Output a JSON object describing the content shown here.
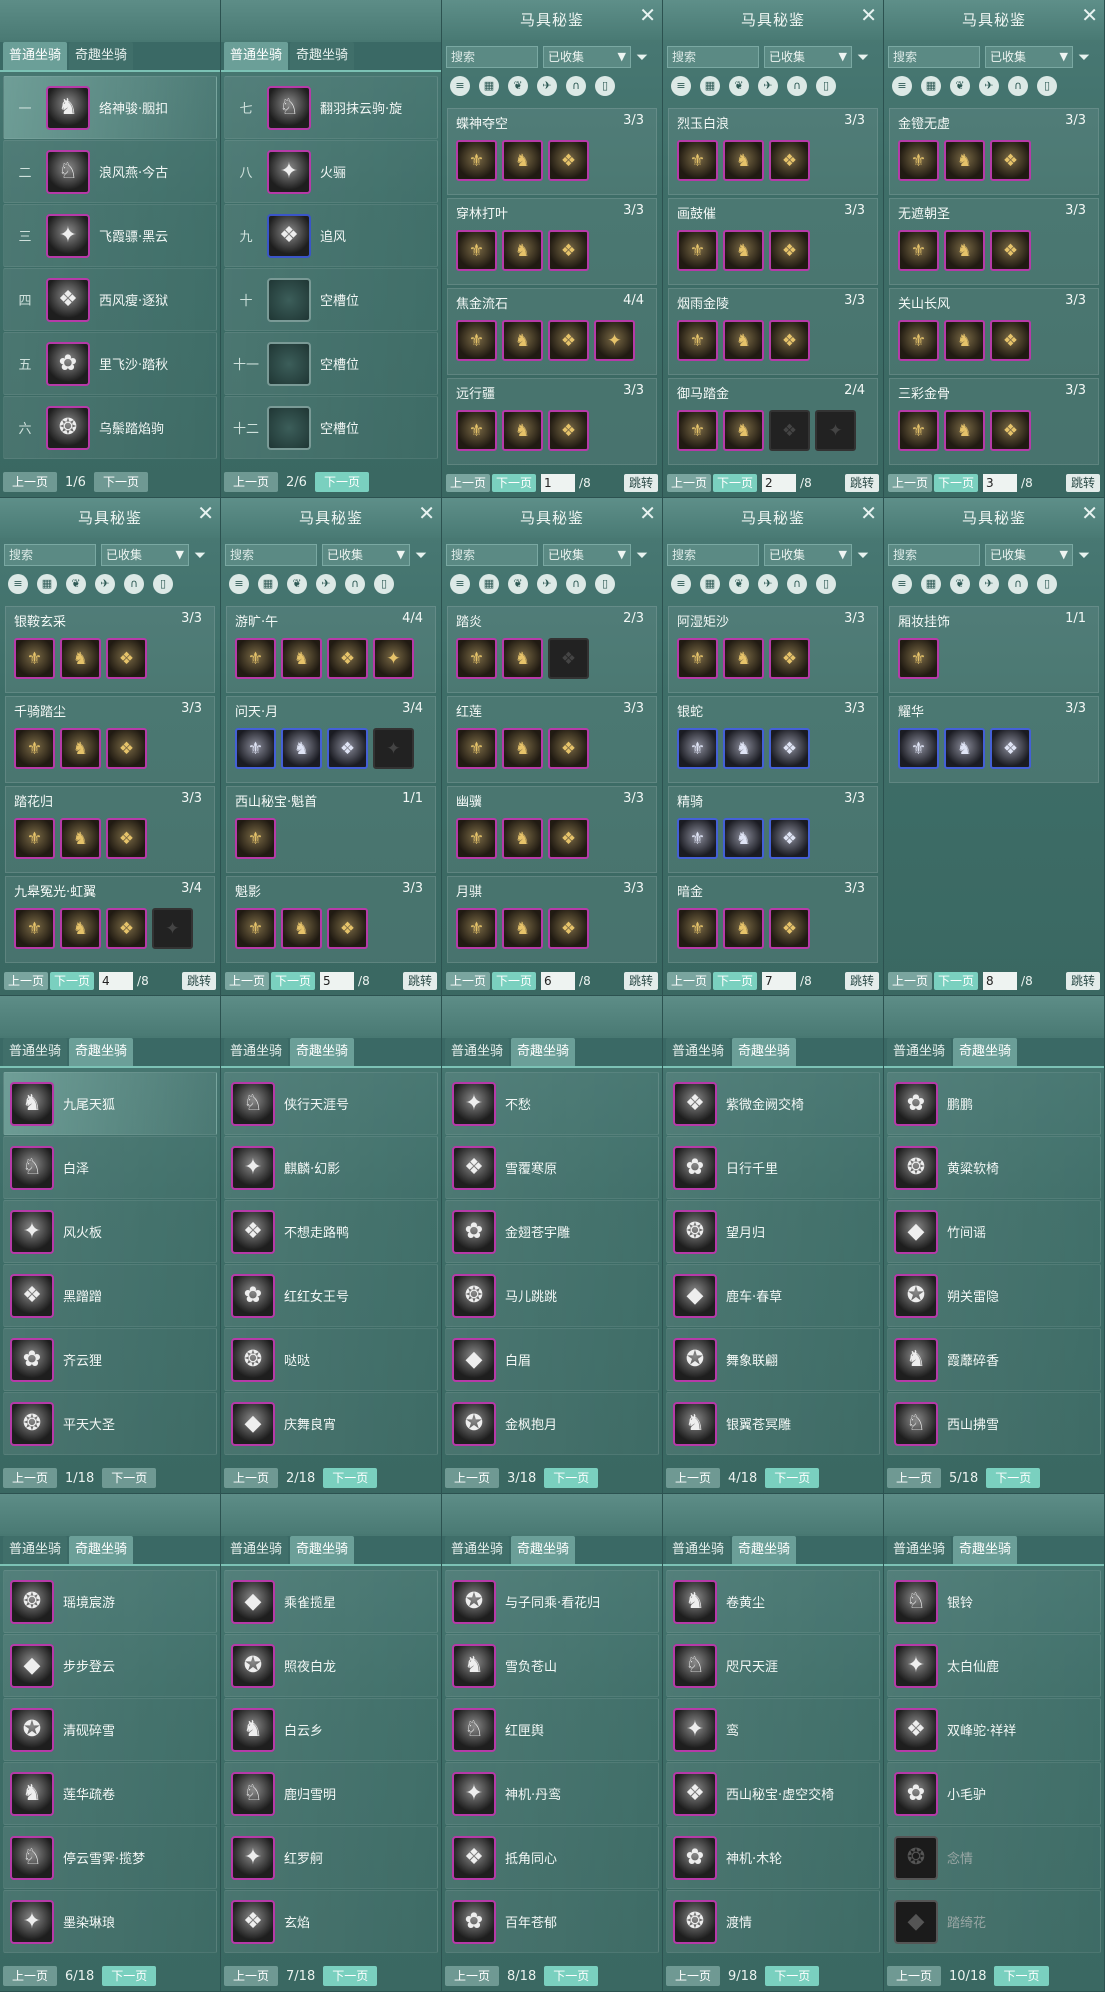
{
  "tabs": {
    "normal": "普通坐骑",
    "fun": "奇趣坐骑"
  },
  "pager": {
    "prev": "上一页",
    "next": "下一页"
  },
  "collection": {
    "title": "马具秘鉴",
    "search_placeholder": "搜索",
    "filter": "已收集",
    "jump": "跳转",
    "total": "/8"
  },
  "icons": {
    "close": "close-icon",
    "funnel": "funnel-icon",
    "tab_active_color": "#6b9f98",
    "accent": "#7ad0bf"
  },
  "normal_pages": [
    {
      "page": "1/6",
      "rows": [
        {
          "num": "一",
          "name": "络神骏·胭扣"
        },
        {
          "num": "二",
          "name": "浪风燕·今古"
        },
        {
          "num": "三",
          "name": "飞霞骠·黑云"
        },
        {
          "num": "四",
          "name": "西风瘦·逐狱"
        },
        {
          "num": "五",
          "name": "里飞沙·踏秋"
        },
        {
          "num": "六",
          "name": "乌鬃踏焰驹"
        }
      ]
    },
    {
      "page": "2/6",
      "rows": [
        {
          "num": "七",
          "name": "翻羽抹云驹·旋"
        },
        {
          "num": "八",
          "name": "火骊"
        },
        {
          "num": "九",
          "name": "追风"
        },
        {
          "num": "十",
          "name": "空槽位"
        },
        {
          "num": "十一",
          "name": "空槽位"
        },
        {
          "num": "十二",
          "name": "空槽位"
        }
      ]
    }
  ],
  "sets_pages": [
    {
      "page": "1",
      "sets": [
        {
          "name": "蝶神夺空",
          "count": "3/3",
          "n": 3
        },
        {
          "name": "穿林打叶",
          "count": "3/3",
          "n": 3
        },
        {
          "name": "焦金流石",
          "count": "4/4",
          "n": 4
        },
        {
          "name": "远行疆",
          "count": "3/3",
          "n": 3
        }
      ]
    },
    {
      "page": "2",
      "sets": [
        {
          "name": "烈玉白浪",
          "count": "3/3",
          "n": 3
        },
        {
          "name": "画鼓催",
          "count": "3/3",
          "n": 3
        },
        {
          "name": "烟雨金陵",
          "count": "3/3",
          "n": 3
        },
        {
          "name": "御马踏金",
          "count": "2/4",
          "n": 4
        }
      ]
    },
    {
      "page": "3",
      "sets": [
        {
          "name": "金镫无虚",
          "count": "3/3",
          "n": 3
        },
        {
          "name": "无遮朝圣",
          "count": "3/3",
          "n": 3
        },
        {
          "name": "关山长风",
          "count": "3/3",
          "n": 3
        },
        {
          "name": "三彩金骨",
          "count": "3/3",
          "n": 3
        }
      ]
    },
    {
      "page": "4",
      "sets": [
        {
          "name": "银鞍玄采",
          "count": "3/3",
          "n": 3
        },
        {
          "name": "千骑踏尘",
          "count": "3/3",
          "n": 3
        },
        {
          "name": "踏花归",
          "count": "3/3",
          "n": 3
        },
        {
          "name": "九皋冤光·虹翼",
          "count": "3/4",
          "n": 4
        }
      ]
    },
    {
      "page": "5",
      "sets": [
        {
          "name": "游旷·午",
          "count": "4/4",
          "n": 4
        },
        {
          "name": "问天·月",
          "count": "3/4",
          "n": 4
        },
        {
          "name": "西山秘宝·魁首",
          "count": "1/1",
          "n": 1
        },
        {
          "name": "魁影",
          "count": "3/3",
          "n": 3
        }
      ]
    },
    {
      "page": "6",
      "sets": [
        {
          "name": "踏炎",
          "count": "2/3",
          "n": 3
        },
        {
          "name": "红莲",
          "count": "3/3",
          "n": 3
        },
        {
          "name": "幽骥",
          "count": "3/3",
          "n": 3
        },
        {
          "name": "月骐",
          "count": "3/3",
          "n": 3
        }
      ]
    },
    {
      "page": "7",
      "sets": [
        {
          "name": "阿湿矩沙",
          "count": "3/3",
          "n": 3
        },
        {
          "name": "银蛇",
          "count": "3/3",
          "n": 3
        },
        {
          "name": "精骑",
          "count": "3/3",
          "n": 3
        },
        {
          "name": "暗金",
          "count": "3/3",
          "n": 3
        }
      ]
    },
    {
      "page": "8",
      "sets": [
        {
          "name": "厢妆挂饰",
          "count": "1/1",
          "n": 1
        },
        {
          "name": "耀华",
          "count": "3/3",
          "n": 3
        }
      ]
    }
  ],
  "fun_pages": [
    {
      "page": "1/18",
      "items": [
        "九尾天狐",
        "白泽",
        "风火板",
        "黑蹭蹭",
        "齐云狸",
        "平天大圣"
      ]
    },
    {
      "page": "2/18",
      "items": [
        "侠行天涯号",
        "麒麟·幻影",
        "不想走路鸭",
        "红红女王号",
        "哒哒",
        "庆舞良宵"
      ]
    },
    {
      "page": "3/18",
      "items": [
        "不愁",
        "雪覆寒原",
        "金翅苍宇雕",
        "马儿跳跳",
        "白眉",
        "金枫抱月"
      ]
    },
    {
      "page": "4/18",
      "items": [
        "紫微金阙交椅",
        "日行千里",
        "望月归",
        "鹿车·春草",
        "舞象联翩",
        "银翼苍冥雕"
      ]
    },
    {
      "page": "5/18",
      "items": [
        "鹏鹏",
        "黄粱软椅",
        "竹间谣",
        "朔关雷隐",
        "霞蘼碎香",
        "西山拂雪"
      ]
    },
    {
      "page": "6/18",
      "items": [
        "瑶境宸游",
        "步步登云",
        "清砚碎雪",
        "莲华疏卷",
        "停云雪霁·揽梦",
        "墨染琳琅"
      ]
    },
    {
      "page": "7/18",
      "items": [
        "乘雀揽星",
        "照夜白龙",
        "白云乡",
        "鹿归雪明",
        "红罗舸",
        "玄焰"
      ]
    },
    {
      "page": "8/18",
      "items": [
        "与子同乘·看花归",
        "雪负苍山",
        "红匣舆",
        "神机·丹鸾",
        "抵角同心",
        "百年苍郁"
      ]
    },
    {
      "page": "9/18",
      "items": [
        "卷黄尘",
        "咫尺天涯",
        "鸾",
        "西山秘宝·虚空交椅",
        "神机·木轮",
        "渡情"
      ]
    },
    {
      "page": "10/18",
      "items": [
        "银铃",
        "太白仙鹿",
        "双峰驼·祥祥",
        "小毛驴",
        "念情",
        "踏绮花"
      ]
    }
  ]
}
